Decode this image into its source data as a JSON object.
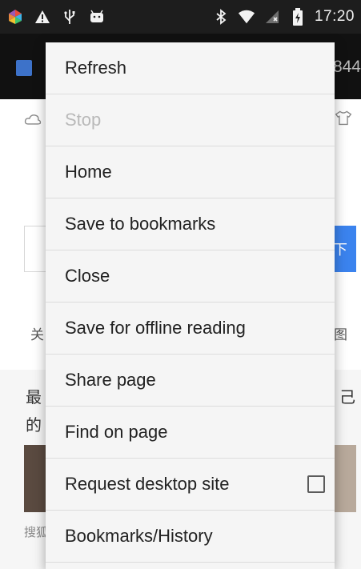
{
  "status_bar": {
    "time": "17:20",
    "icons": [
      "color-app-icon",
      "warning-icon",
      "usb-icon",
      "android-icon",
      "bluetooth-icon",
      "wifi-icon",
      "no-signal-icon",
      "battery-charging-icon"
    ]
  },
  "toolbar": {
    "url_tail": "844"
  },
  "page": {
    "search_button": "下",
    "left_chars_1": "关",
    "right_chars_1": "图",
    "headline_left_1": "最",
    "headline_left_2": "的",
    "headline_right": "己",
    "source_left": "搜狐"
  },
  "menu": {
    "items": [
      {
        "label": "Refresh",
        "enabled": true
      },
      {
        "label": "Stop",
        "enabled": false
      },
      {
        "label": "Home",
        "enabled": true
      },
      {
        "label": "Save to bookmarks",
        "enabled": true
      },
      {
        "label": "Close",
        "enabled": true
      },
      {
        "label": "Save for offline reading",
        "enabled": true
      },
      {
        "label": "Share page",
        "enabled": true
      },
      {
        "label": "Find on page",
        "enabled": true
      },
      {
        "label": "Request desktop site",
        "enabled": true,
        "checked": false
      },
      {
        "label": "Bookmarks/History",
        "enabled": true
      }
    ]
  },
  "colors": {
    "status_bar": "#1d1d1d",
    "toolbar": "#111111",
    "menu_background": "#f5f5f5",
    "accent": "#3b83ee"
  }
}
